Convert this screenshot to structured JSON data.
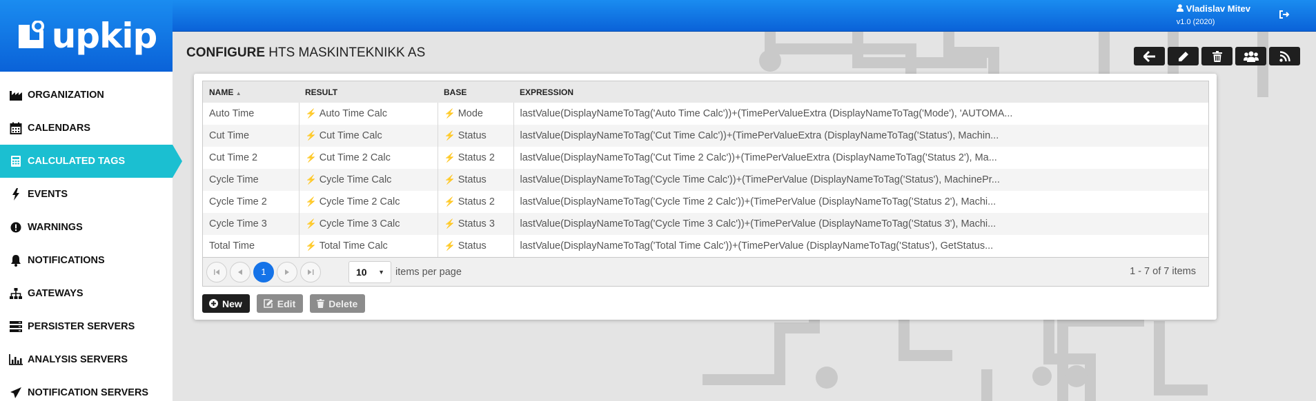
{
  "app": {
    "logo_text": "upkip"
  },
  "user": {
    "name": "Vladislav Mitev",
    "version": "v1.0 (2020)"
  },
  "sidebar": {
    "items": [
      {
        "label": "ORGANIZATION",
        "icon": "factory-icon"
      },
      {
        "label": "CALENDARS",
        "icon": "calendar-icon"
      },
      {
        "label": "CALCULATED TAGS",
        "icon": "calculator-icon",
        "active": true
      },
      {
        "label": "EVENTS",
        "icon": "bolt-icon"
      },
      {
        "label": "WARNINGS",
        "icon": "exclamation-icon"
      },
      {
        "label": "NOTIFICATIONS",
        "icon": "bell-icon"
      },
      {
        "label": "GATEWAYS",
        "icon": "sitemap-icon"
      },
      {
        "label": "PERSISTER SERVERS",
        "icon": "server-icon"
      },
      {
        "label": "ANALYSIS SERVERS",
        "icon": "bar-chart-icon"
      },
      {
        "label": "NOTIFICATION SERVERS",
        "icon": "send-icon"
      }
    ]
  },
  "page": {
    "title_bold": "CONFIGURE",
    "title_rest": "HTS MASKINTEKNIKK AS"
  },
  "grid": {
    "columns": [
      "NAME",
      "RESULT",
      "BASE",
      "EXPRESSION"
    ],
    "sort_indicator": "▲",
    "rows": [
      {
        "name": "Auto Time",
        "result": "Auto Time Calc",
        "base": "Mode",
        "expression": "lastValue(DisplayNameToTag('Auto Time Calc'))+(TimePerValueExtra (DisplayNameToTag('Mode'), 'AUTOMA..."
      },
      {
        "name": "Cut Time",
        "result": "Cut Time Calc",
        "base": "Status",
        "expression": "lastValue(DisplayNameToTag('Cut Time Calc'))+(TimePerValueExtra (DisplayNameToTag('Status'), Machin..."
      },
      {
        "name": "Cut Time 2",
        "result": "Cut Time 2 Calc",
        "base": "Status 2",
        "expression": "lastValue(DisplayNameToTag('Cut Time 2 Calc'))+(TimePerValueExtra (DisplayNameToTag('Status 2'), Ma..."
      },
      {
        "name": "Cycle Time",
        "result": "Cycle Time Calc",
        "base": "Status",
        "expression": "lastValue(DisplayNameToTag('Cycle Time Calc'))+(TimePerValue (DisplayNameToTag('Status'), MachinePr..."
      },
      {
        "name": "Cycle Time 2",
        "result": "Cycle Time 2 Calc",
        "base": "Status 2",
        "expression": "lastValue(DisplayNameToTag('Cycle Time 2 Calc'))+(TimePerValue (DisplayNameToTag('Status 2'), Machi..."
      },
      {
        "name": "Cycle Time 3",
        "result": "Cycle Time 3 Calc",
        "base": "Status 3",
        "expression": "lastValue(DisplayNameToTag('Cycle Time 3 Calc'))+(TimePerValue (DisplayNameToTag('Status 3'), Machi..."
      },
      {
        "name": "Total Time",
        "result": "Total Time Calc",
        "base": "Status",
        "expression": "lastValue(DisplayNameToTag('Total Time Calc'))+(TimePerValue (DisplayNameToTag('Status'), GetStatus..."
      }
    ]
  },
  "pager": {
    "current_page": "1",
    "page_size": "10",
    "items_per_page_label": "items per page",
    "info": "1 - 7 of 7 items"
  },
  "actions": {
    "new_label": "New",
    "edit_label": "Edit",
    "delete_label": "Delete"
  },
  "colors": {
    "brand_blue": "#0a62d8",
    "active_nav": "#1bbfd1",
    "bolt": "#f2b705",
    "page_current": "#1573e8"
  }
}
